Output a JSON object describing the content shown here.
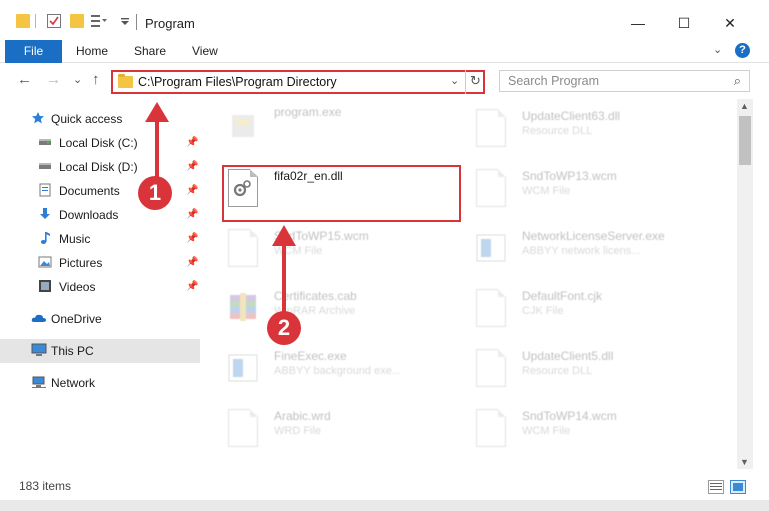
{
  "window": {
    "title": "Program",
    "minimize_glyph": "—",
    "maximize_glyph": "☐",
    "close_glyph": "✕"
  },
  "ribbon": {
    "file_label": "File",
    "home_label": "Home",
    "share_label": "Share",
    "view_label": "View",
    "help_glyph": "?",
    "expand_glyph": "⌄"
  },
  "nav": {
    "back_glyph": "←",
    "forward_glyph": "→",
    "recent_glyph": "⌄",
    "up_glyph": "↑",
    "address": "C:\\Program Files\\Program Directory",
    "address_dropdown_glyph": "⌄",
    "refresh_glyph": "↻",
    "search_placeholder": "Search Program",
    "search_glyph": "⌕"
  },
  "sidebar": {
    "items": [
      {
        "label": "Quick access",
        "icon": "star-icon",
        "pinned": false
      },
      {
        "label": "Local Disk (C:)",
        "icon": "drive-icon",
        "pinned": true
      },
      {
        "label": "Local Disk (D:)",
        "icon": "drive-icon",
        "pinned": true
      },
      {
        "label": "Documents",
        "icon": "documents-icon",
        "pinned": true
      },
      {
        "label": "Downloads",
        "icon": "downloads-icon",
        "pinned": true
      },
      {
        "label": "Music",
        "icon": "music-icon",
        "pinned": true
      },
      {
        "label": "Pictures",
        "icon": "pictures-icon",
        "pinned": true
      },
      {
        "label": "Videos",
        "icon": "videos-icon",
        "pinned": true
      },
      {
        "label": "OneDrive",
        "icon": "onedrive-icon",
        "pinned": false
      },
      {
        "label": "This PC",
        "icon": "pc-icon",
        "pinned": false,
        "selected": true
      },
      {
        "label": "Network",
        "icon": "network-icon",
        "pinned": false
      }
    ],
    "pin_glyph": "📌"
  },
  "files": {
    "left": [
      {
        "name": "program.exe",
        "type": "",
        "icon": "exe-icon",
        "dim": true
      },
      {
        "name": "fifa02r_en.dll",
        "type": "",
        "icon": "dll-gear-icon",
        "dim": false
      },
      {
        "name": "SndToWP15.wcm",
        "type": "WCM File",
        "icon": "blank-file-icon",
        "dim": true
      },
      {
        "name": "Certificates.cab",
        "type": "WinRAR Archive",
        "icon": "archive-icon",
        "dim": true
      },
      {
        "name": "FineExec.exe",
        "type": "ABBYY background exe...",
        "icon": "app-icon",
        "dim": true
      },
      {
        "name": "Arabic.wrd",
        "type": "WRD File",
        "icon": "blank-file-icon",
        "dim": true
      }
    ],
    "right": [
      {
        "name": "UpdateClient63.dll",
        "type": "Resource DLL",
        "icon": "dll-gear-icon",
        "dim": true
      },
      {
        "name": "SndToWP13.wcm",
        "type": "WCM File",
        "icon": "blank-file-icon",
        "dim": true
      },
      {
        "name": "NetworkLicenseServer.exe",
        "type": "ABBYY network licens...",
        "icon": "app-icon",
        "dim": true
      },
      {
        "name": "DefaultFont.cjk",
        "type": "CJK File",
        "icon": "blank-file-icon",
        "dim": true
      },
      {
        "name": "UpdateClient5.dll",
        "type": "Resource DLL",
        "icon": "dll-gear-icon",
        "dim": true
      },
      {
        "name": "SndToWP14.wcm",
        "type": "WCM File",
        "icon": "blank-file-icon",
        "dim": true
      }
    ]
  },
  "status": {
    "item_count": "183 items"
  },
  "annotations": {
    "step1": "1",
    "step2": "2",
    "color": "#d9343a"
  },
  "colors": {
    "accent": "#1a6ec4",
    "folder": "#f4c542",
    "selection": "#e5e5e5"
  }
}
